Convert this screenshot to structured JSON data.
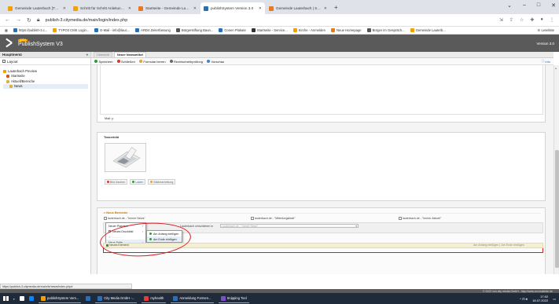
{
  "browser": {
    "tabs": [
      {
        "title": "Gemeinde Lauterbach [TYPO3 C",
        "color": "#f2a100",
        "active": false
      },
      {
        "title": "Schritt für Schritt Anleitung - Sc",
        "color": "#f2a100",
        "active": false
      },
      {
        "title": "Startseite - Gemeinde Lauterbach",
        "color": "#e57b1e",
        "active": false
      },
      {
        "title": "publishSystem Version 3.0",
        "color": "#2a6fb5",
        "active": true
      },
      {
        "title": "Gemeinde Lauterbach | Startseit",
        "color": "#e57b1e",
        "active": false
      }
    ],
    "new_tab": "+",
    "window_controls": [
      "⌄",
      "–",
      "□",
      "✕"
    ],
    "url": "publish-3.citymedia.de/main/login/index.php",
    "bookmarks": [
      {
        "label": "https://publish-3.c...",
        "color": "#2a6fb5"
      },
      {
        "label": "TYPO3 CMS Login...",
        "color": "#f2a100"
      },
      {
        "label": "E-Mail - info@lauc...",
        "color": "#2a6fb5"
      },
      {
        "label": "ARD4 Zeiterfassung",
        "color": "#2a6fb5"
      },
      {
        "label": "Bürgerstiftung Baun...",
        "color": "#555555"
      },
      {
        "label": "Conen Plakate",
        "color": "#2a6fb5"
      },
      {
        "label": "Startseite - Service...",
        "color": "#333333"
      },
      {
        "label": "Kirche - Anmelden",
        "color": "#f2a100"
      },
      {
        "label": "Neue Homepage",
        "color": "#e57b1e"
      },
      {
        "label": "Bürger im Gespräch...",
        "color": "#555555"
      },
      {
        "label": "Gemeinde Lauterb...",
        "color": "#f2a100"
      }
    ],
    "reading_list": "Leseliste",
    "status_url": "https://publish-3.citymedia.de/main/le/news/index.php#"
  },
  "app": {
    "brand_tag": "CITY",
    "brand": "PublishSystem V3",
    "version": "Version 3.0"
  },
  "sidebar": {
    "title": "Hauptmenü",
    "layout": "Layout",
    "tree": [
      {
        "label": "Lauterbach Preview",
        "depth": 0,
        "color": "#f2a100"
      },
      {
        "label": "Startseite",
        "depth": 1,
        "color": "#d65a1a"
      },
      {
        "label": "Aktuell/Bereiche",
        "depth": 1,
        "color": "#d9b24a"
      },
      {
        "label": "News",
        "depth": 2,
        "color": "#d9b24a"
      }
    ]
  },
  "main": {
    "tabs": [
      {
        "label": "Übersicht",
        "active": false
      },
      {
        "label": "Neuer Newsartikel",
        "active": true
      }
    ],
    "toolbar": [
      {
        "label": "Speichern",
        "color": "#2e9b3a"
      },
      {
        "label": "Schließen",
        "color": "#d33b2b"
      },
      {
        "label": "Formular leeren",
        "color": "#e0a23a"
      },
      {
        "label": "Rechtschreibprüfung",
        "color": "#666666"
      },
      {
        "label": "Vorschau",
        "color": "#4a7fc1"
      }
    ],
    "help": "Info",
    "mail_label": "Mail: p",
    "teaser": {
      "title": "Teaserbild",
      "buttons": [
        {
          "label": "Bild löschen",
          "color": "#d33b2b",
          "active": false
        },
        {
          "label": "Laden",
          "color": "#2e9b3a",
          "active": true
        },
        {
          "label": "Bildbearbeitung",
          "color": "#e0a23a",
          "active": false
        }
      ]
    },
    "bereiche": {
      "title": "Neue Bereiche",
      "checkboxes": [
        "lauterbach.de - \"Immer News\"",
        "lauterbach.de - \"Mitteilungsblatt\"",
        "lauterbach.de - \"Immer Aktuell\""
      ],
      "select_left": "Neuer Platztext",
      "select_mid": "Lauterbach.de - \"Immer News\"",
      "label_move": "Lauterbach verschieben in",
      "menu1": [
        "Neuer Platztext",
        "Neues Druckbild"
      ],
      "menu2": [
        "Neue Seite"
      ],
      "menu3": [
        "Am Anfang einfügen",
        "Am Ende einfügen"
      ],
      "new_element": "Neues Element",
      "right_links": [
        "Am Anfang einfügen",
        "Am Ende einfügen"
      ]
    }
  },
  "footer": "© 2022 von city media GmbH - http://www.cm-bustede.de",
  "taskbar": {
    "items": [
      {
        "label": "",
        "color": "#ffffff",
        "task": false
      },
      {
        "label": "",
        "color": "#0a84ff",
        "task": false
      },
      {
        "label": "publishSystem Vers...",
        "color": "#f2a100",
        "task": true
      },
      {
        "label": "",
        "color": "#2a6fb5",
        "task": false
      },
      {
        "label": "City Media GmbH -...",
        "color": "#2a6fb5",
        "task": true
      },
      {
        "label": "myhealth",
        "color": "#e83a3a",
        "task": true
      },
      {
        "label": "Anmeldung Formen...",
        "color": "#2a6fb5",
        "task": true
      },
      {
        "label": "Snipping Tool",
        "color": "#7b4fc9",
        "task": true
      }
    ],
    "time": "17:02",
    "date": "18.07.2022"
  }
}
